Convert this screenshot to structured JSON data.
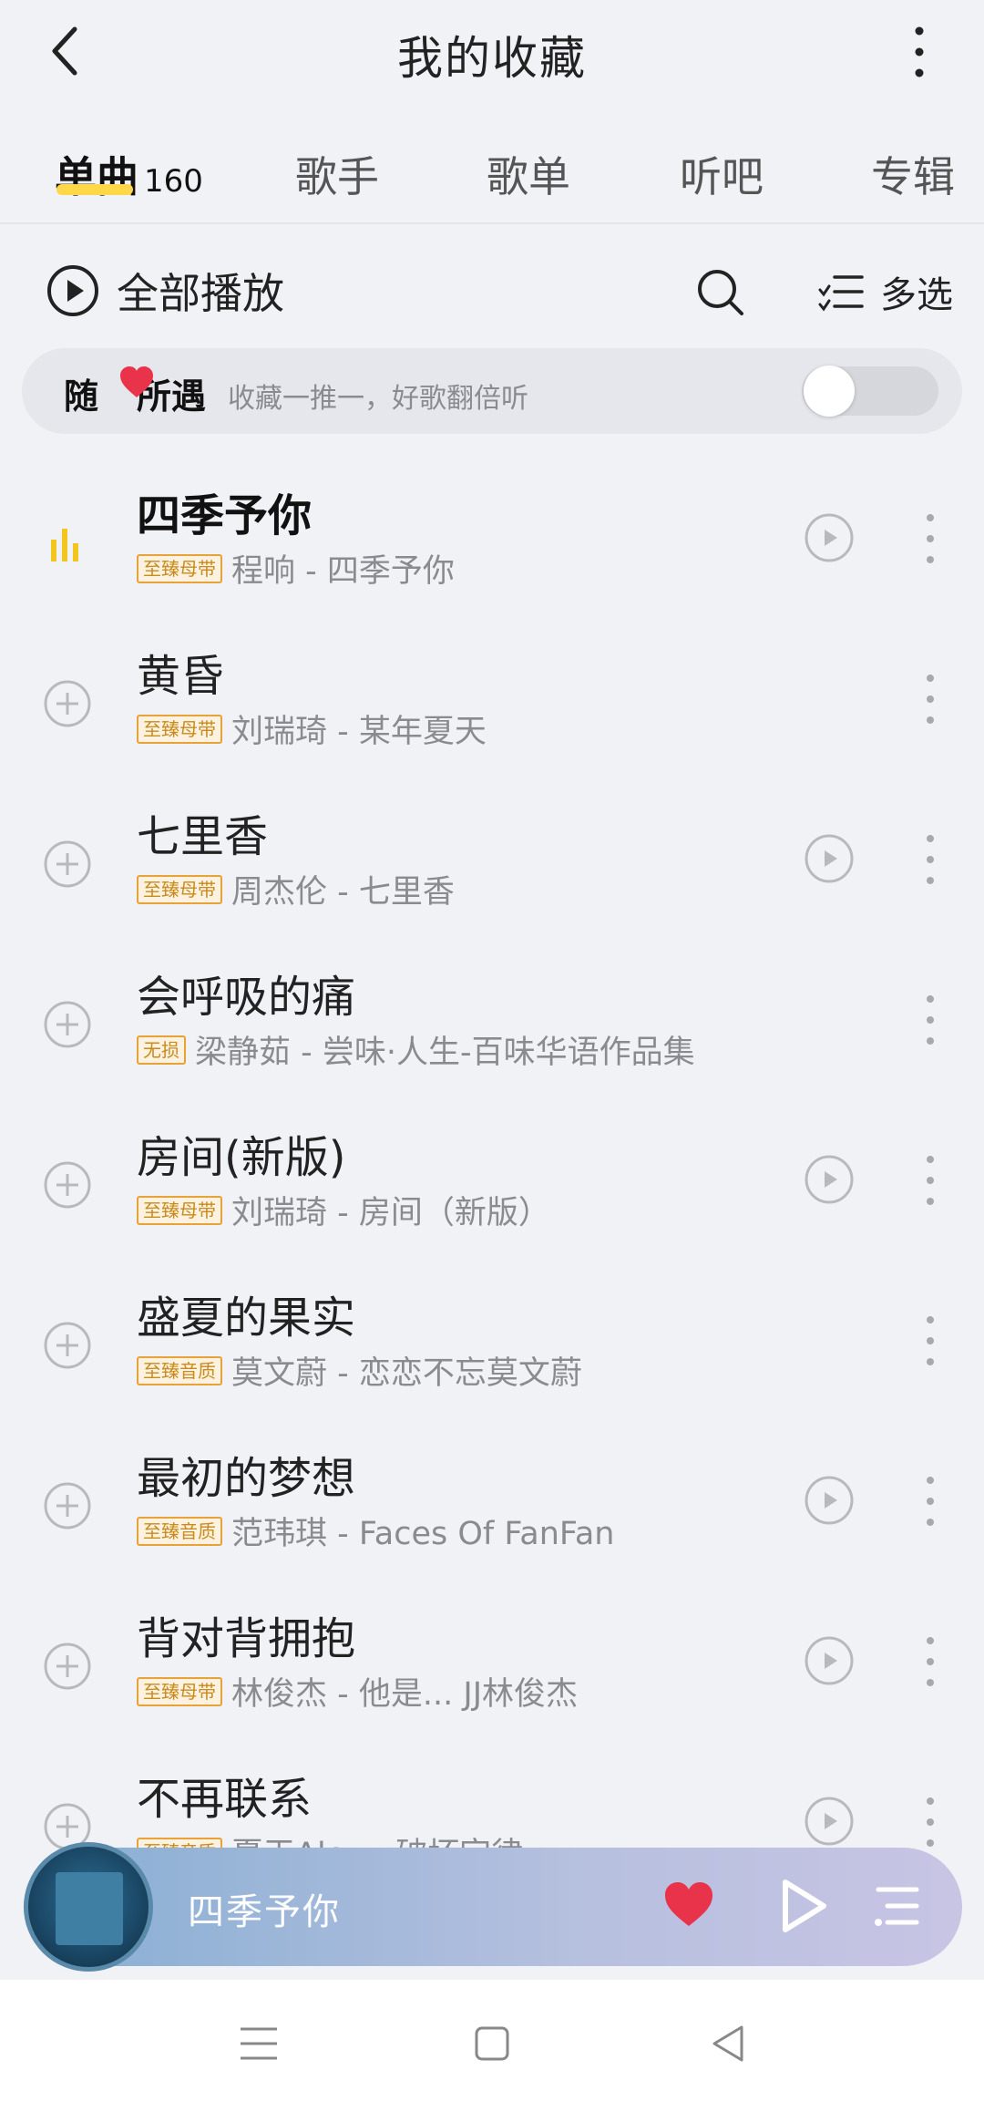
{
  "header": {
    "title": "我的收藏"
  },
  "tabs": [
    {
      "label": "单曲",
      "count": "160"
    },
    {
      "label": "歌手"
    },
    {
      "label": "歌单"
    },
    {
      "label": "听吧"
    },
    {
      "label": "专辑"
    }
  ],
  "toolbar": {
    "play_all": "全部播放",
    "multi_select": "多选"
  },
  "random": {
    "title_a": "随",
    "title_b": "所遇",
    "subtitle": "收藏一推一，好歌翻倍听",
    "enabled": false
  },
  "songs": [
    {
      "title": "四季予你",
      "badge": "至臻母带",
      "artist_album": "程响 - 四季予你",
      "playing": true
    },
    {
      "title": "黄昏",
      "badge": "至臻母带",
      "artist_album": "刘瑞琦 - 某年夏天"
    },
    {
      "title": "七里香",
      "badge": "至臻母带",
      "artist_album": "周杰伦 - 七里香"
    },
    {
      "title": "会呼吸的痛",
      "badge": "无损",
      "artist_album": "梁静茹 - 尝味·人生-百味华语作品集"
    },
    {
      "title": "房间(新版)",
      "badge": "至臻母带",
      "artist_album": "刘瑞琦 - 房间（新版）"
    },
    {
      "title": "盛夏的果实",
      "badge": "至臻音质",
      "artist_album": "莫文蔚 - 恋恋不忘莫文蔚"
    },
    {
      "title": "最初的梦想",
      "badge": "至臻音质",
      "artist_album": "范玮琪 - Faces Of FanFan"
    },
    {
      "title": "背对背拥抱",
      "badge": "至臻母带",
      "artist_album": "林俊杰 - 他是... JJ林俊杰"
    },
    {
      "title": "不再联系",
      "badge": "至臻音质",
      "artist_album": "夏天Alex - 破坏定律"
    }
  ],
  "mini_player": {
    "title": "四季予你"
  },
  "colors": {
    "accent": "#ffd84a",
    "heart": "#e8334a",
    "playing_bars": "#f2c61f"
  }
}
